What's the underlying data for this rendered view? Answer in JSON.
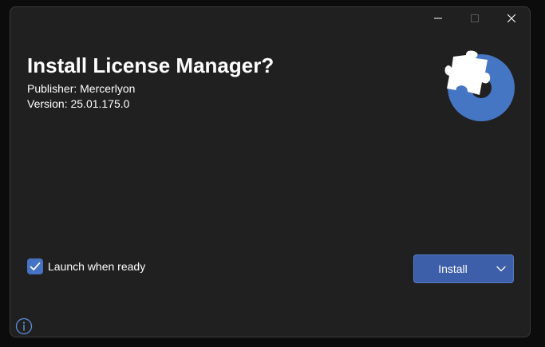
{
  "window": {
    "minimize_icon": "minimize-icon",
    "maximize_icon": "maximize-icon",
    "close_icon": "close-icon"
  },
  "header": {
    "title": "Install License Manager?",
    "publisher": "Publisher: Mercerlyon",
    "version": "Version: 25.01.175.0",
    "app_icon": "puzzle-piece-disc-icon"
  },
  "options": {
    "launch_when_ready": {
      "label": "Launch when ready",
      "checked": true
    }
  },
  "actions": {
    "install_label": "Install",
    "dropdown_icon": "chevron-down-icon"
  },
  "footer": {
    "info_icon": "info-icon"
  },
  "colors": {
    "background": "#202020",
    "accent": "#3d5ea8",
    "checkbox": "#4672c4",
    "icon_blue": "#4576c4",
    "text": "#ffffff"
  }
}
